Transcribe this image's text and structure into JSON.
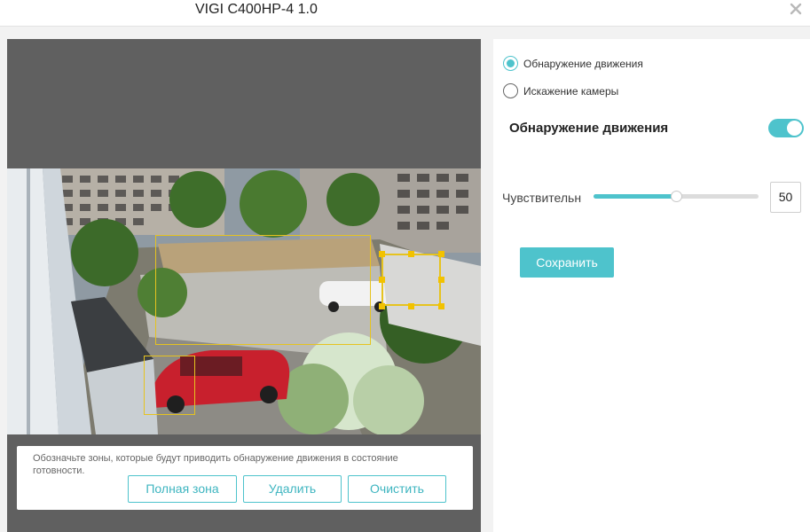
{
  "window": {
    "title": "VIGI C400HP-4 1.0",
    "close_icon": "close-icon"
  },
  "camera": {
    "hint": "Обозначьте зоны, которые будут приводить обнаружение движения в состояние готовности.",
    "buttons": {
      "full_zone": "Полная зона",
      "delete": "Удалить",
      "clear": "Очистить"
    }
  },
  "settings": {
    "mode_options": [
      {
        "label": "Обнаружение движения",
        "checked": true
      },
      {
        "label": "Искажение камеры",
        "checked": false
      }
    ],
    "section_title": "Обнаружение движения",
    "enabled": true,
    "sensitivity_label": "Чувствительн",
    "sensitivity_value": "50",
    "sensitivity_fraction": 0.5,
    "save_label": "Сохранить"
  },
  "colors": {
    "accent": "#4ec3cc",
    "zone": "#e6c31f",
    "panel_bg": "#606060"
  }
}
